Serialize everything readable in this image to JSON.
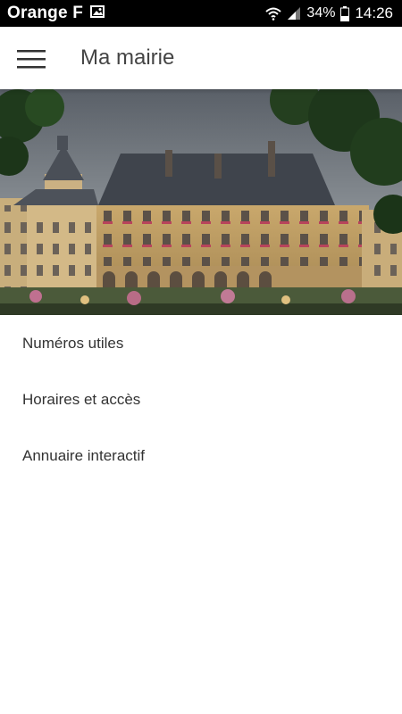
{
  "status_bar": {
    "carrier": "Orange F",
    "battery": "34%",
    "time": "14:26"
  },
  "app_bar": {
    "title": "Ma mairie",
    "menu_icon": "hamburger-menu-icon"
  },
  "hero": {
    "image": "town-hall-photo"
  },
  "menu": {
    "items": [
      {
        "label": "Numéros utiles"
      },
      {
        "label": "Horaires et accès"
      },
      {
        "label": "Annuaire interactif"
      }
    ]
  },
  "colors": {
    "status_bar_bg": "#000000",
    "app_bar_bg": "#ffffff",
    "title_text": "#444444",
    "item_text": "#333333"
  }
}
